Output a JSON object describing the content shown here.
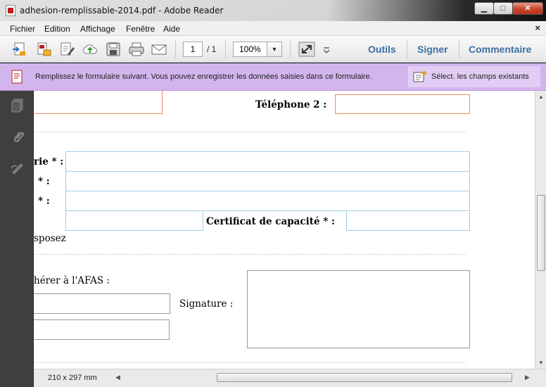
{
  "window": {
    "title": "adhesion-remplissable-2014.pdf - Adobe Reader",
    "min_label": "▁",
    "max_label": "□",
    "close_label": "✕"
  },
  "menu": {
    "items": [
      "Fichier",
      "Edition",
      "Affichage",
      "Fenêtre",
      "Aide"
    ],
    "close": "×"
  },
  "toolbar": {
    "page_current": "1",
    "page_total": "/ 1",
    "zoom": "100%",
    "links": [
      "Outils",
      "Signer",
      "Commentaire"
    ]
  },
  "infobar": {
    "message": "Remplissez le formulaire suivant. Vous pouvez enregistrer les données saisies dans ce formulaire.",
    "select_fields": "Sélect. les champs existants"
  },
  "document": {
    "telephone2": "Téléphone 2 :",
    "label_rie": "rie * :",
    "label_star1": "* :",
    "label_star2": "* :",
    "certificat": "Certificat de capacité * :",
    "sposez": "sposez",
    "adherer": "hérer à l'AFAS :",
    "signature": "Signature :"
  },
  "status": {
    "page_size": "210 x 297 mm"
  },
  "colors": {
    "infobar": "#d3b5ee",
    "link": "#3b6fa3",
    "field_orange": "#f08a5a",
    "field_blue": "#9fcfe6"
  }
}
